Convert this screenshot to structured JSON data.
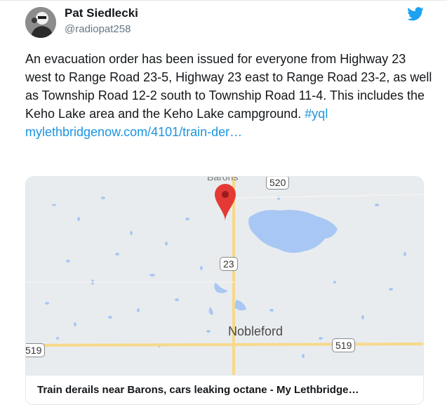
{
  "author": {
    "name": "Pat Siedlecki",
    "handle": "@radiopat258"
  },
  "tweet": {
    "text": "An evacuation order has been issued for everyone from Highway 23 west to Range Road 23-5, Highway 23 east to Range Road 23-2, as well as Township Road 12-2 south to Township Road 11-4. This includes the Keho Lake area and the Keho Lake campground. ",
    "hashtag": "#yql",
    "link": "mylethbridgenow.com/4101/train-der…"
  },
  "map": {
    "town_top": "Barons",
    "town_label": "Nobleford",
    "shields": [
      "520",
      "23",
      "519",
      "519"
    ]
  },
  "card": {
    "title": "Train derails near Barons, cars leaking octane - My Lethbridge…"
  },
  "icons": {
    "brand": "twitter-bird-icon",
    "pin": "map-pin-icon"
  },
  "colors": {
    "link": "#1b95e0",
    "brand": "#1da1f2",
    "pin": "#e53935",
    "lake": "#a8c7f4",
    "road": "#f6d98a"
  }
}
